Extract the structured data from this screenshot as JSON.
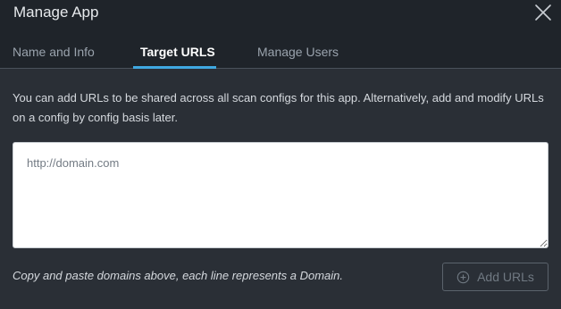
{
  "dialog": {
    "title": "Manage App"
  },
  "tabs": [
    {
      "label": "Name and Info",
      "active": false
    },
    {
      "label": "Target URLS",
      "active": true
    },
    {
      "label": "Manage Users",
      "active": false
    }
  ],
  "content": {
    "description": "You can add URLs to be shared across all scan configs for this app. Alternatively, add and modify URLs on a config by config basis later.",
    "textarea_placeholder": "http://domain.com",
    "textarea_value": "",
    "hint": "Copy and paste domains above, each line represents a Domain."
  },
  "actions": {
    "add_urls_label": "Add URLs",
    "add_urls_icon": "plus-circle-icon",
    "add_urls_enabled": false
  },
  "colors": {
    "accent": "#3fa8e0",
    "header_bg": "#1f242a",
    "body_bg": "#2a2f36"
  }
}
